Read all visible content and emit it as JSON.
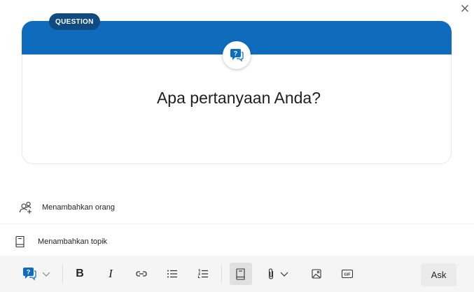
{
  "card": {
    "badge": "QUESTION",
    "placeholder": "Apa pertanyaan Anda?",
    "band_color": "#0f6cbd",
    "badge_color": "#0f4a80"
  },
  "rows": {
    "add_people": "Menambahkan orang",
    "add_topic": "Menambahkan topik"
  },
  "toolbar": {
    "ask_label": "Ask",
    "gif_label": "GIF",
    "post_type_icon": "question-bubble-icon"
  }
}
